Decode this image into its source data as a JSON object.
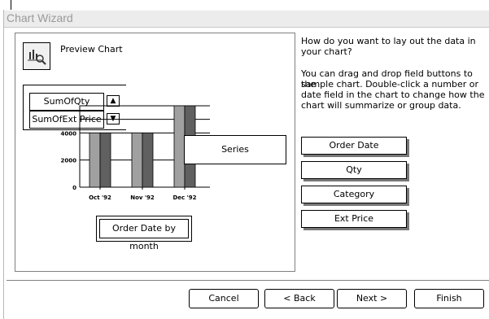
{
  "window": {
    "title": "Chart Wizard"
  },
  "preview": {
    "label": "Preview Chart",
    "icon": "chart-preview-icon"
  },
  "data_fields": [
    "SumOfQty",
    "SumOfExt Price"
  ],
  "series": {
    "label": "Series"
  },
  "axis_field": {
    "label": "Order Date by month"
  },
  "instructions": {
    "line1": "How do you want to lay out the data in",
    "line2": "your chart?",
    "line3": "You can drag and drop field buttons to the",
    "line4": "sample chart. Double-click a number or",
    "line5": "date field in the chart to change how the",
    "line6": "chart will summarize or group data."
  },
  "field_buttons": [
    "Order Date",
    "Qty",
    "Category",
    "Ext Price"
  ],
  "buttons": {
    "cancel": "Cancel",
    "back": "< Back",
    "next": "Next >",
    "finish": "Finish"
  },
  "chart_data": {
    "type": "bar",
    "categories": [
      "Oct '92",
      "Nov '92",
      "Dec '92"
    ],
    "y_ticks": [
      "4000",
      "2000",
      "0"
    ],
    "ylim": [
      0,
      6000
    ],
    "series": [
      {
        "values": [
          4000,
          4000,
          6000
        ],
        "color": "#a0a0a0"
      },
      {
        "values": [
          4000,
          4000,
          6000
        ],
        "color": "#606060"
      }
    ]
  }
}
